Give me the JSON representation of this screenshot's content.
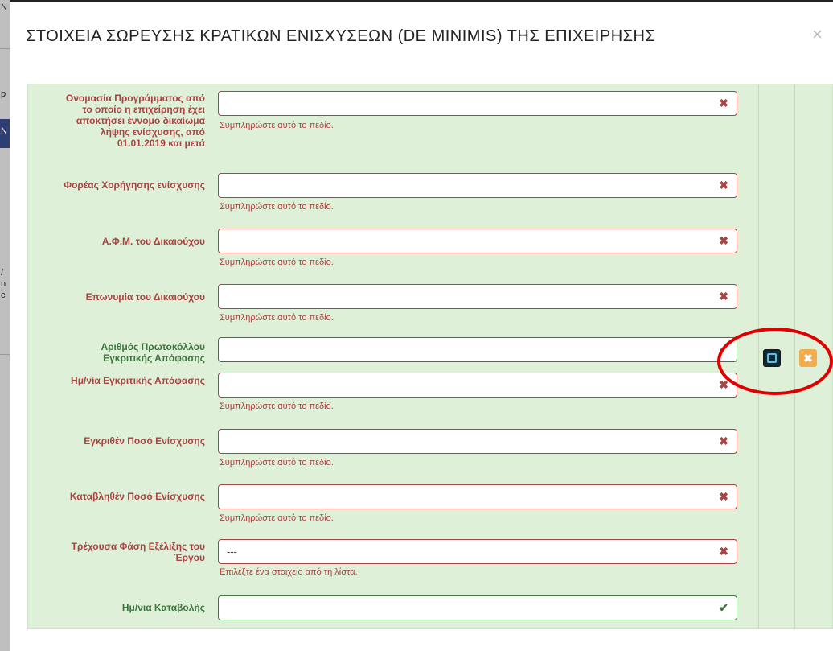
{
  "background": {
    "glyphs": [
      "N",
      "p",
      "N",
      "/",
      "n",
      "c",
      "c"
    ]
  },
  "modal": {
    "title": "ΣΤΟΙΧΕΙΑ ΣΩΡΕΥΣΗΣ ΚΡΑΤΙΚΩΝ ΕΝΙΣΧΥΣΕΩΝ (DE MINIMIS) ΤΗΣ ΕΠΙΧΕΙΡΗΣΗΣ",
    "close_glyph": "×"
  },
  "fields": [
    {
      "label_lines": [
        "Ονομασία Προγράμματος από",
        "το οποίο η επιχείρηση έχει",
        "αποκτήσει έννομο δικαίωμα",
        "λήψης ενίσχυσης, από",
        "01.01.2019 και μετά"
      ],
      "value": "",
      "status": "error",
      "help": "Συμπληρώστε αυτό το πεδίο."
    },
    {
      "label_lines": [
        "Φορέας Χορήγησης ενίσχυσης"
      ],
      "value": "",
      "status": "error",
      "help": "Συμπληρώστε αυτό το πεδίο."
    },
    {
      "label_lines": [
        "Α.Φ.Μ. του Δικαιούχου"
      ],
      "value": "",
      "status": "error",
      "help": "Συμπληρώστε αυτό το πεδίο."
    },
    {
      "label_lines": [
        "Επωνυμία του Δικαιούχου"
      ],
      "value": "",
      "status": "error",
      "help": "Συμπληρώστε αυτό το πεδίο."
    },
    {
      "label_lines": [
        "Αριθμός Πρωτοκόλλου",
        "Εγκριτικής Απόφασης"
      ],
      "value": "",
      "status": "ok",
      "help": ""
    },
    {
      "label_lines": [
        "Ημ/νία Εγκριτικής Απόφασης"
      ],
      "value": "",
      "status": "error",
      "help": "Συμπληρώστε αυτό το πεδίο."
    },
    {
      "label_lines": [
        "Εγκριθέν Ποσό Ενίσχυσης"
      ],
      "value": "",
      "status": "error",
      "help": "Συμπληρώστε αυτό το πεδίο."
    },
    {
      "label_lines": [
        "Καταβληθέν Ποσό Ενίσχυσης"
      ],
      "value": "",
      "status": "error",
      "help": "Συμπληρώστε αυτό το πεδίο."
    },
    {
      "label_lines": [
        "Τρέχουσα Φάση Εξέλιξης του",
        "Έργου"
      ],
      "value": "---",
      "status": "error",
      "help": "Επιλέξτε ένα στοιχείο από τη λίστα."
    },
    {
      "label_lines": [
        "Ημ/νια Καταβολής"
      ],
      "value": "",
      "status": "ok",
      "help": ""
    }
  ],
  "icons": {
    "error": "✖",
    "ok": "✔",
    "save": "check-square-icon",
    "cancel": "close-icon"
  },
  "colors": {
    "error": "#a94442",
    "ok": "#3c763d",
    "form_bg": "#dff0d8",
    "cancel_btn": "#f0ad4e",
    "annotation": "#e00000"
  }
}
